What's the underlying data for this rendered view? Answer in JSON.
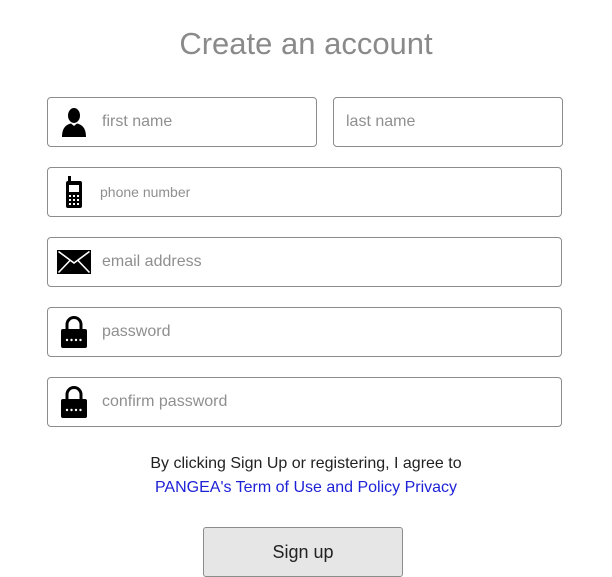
{
  "page": {
    "title": "Create an account"
  },
  "form": {
    "first_name": {
      "placeholder": "first name",
      "value": ""
    },
    "last_name": {
      "placeholder": "last name",
      "value": ""
    },
    "phone": {
      "placeholder": "phone number",
      "value": ""
    },
    "email": {
      "placeholder": "email address",
      "value": ""
    },
    "password": {
      "placeholder": "password",
      "value": ""
    },
    "confirm_password": {
      "placeholder": "confirm password",
      "value": ""
    }
  },
  "icons": {
    "first_name": "person-icon",
    "phone": "mobile-phone-icon",
    "email": "envelope-icon",
    "password": "lock-icon",
    "confirm_password": "lock-icon"
  },
  "terms": {
    "line1": "By clicking Sign Up or registering, I agree to",
    "link_text": "PANGEA's Term of Use and Policy Privacy"
  },
  "buttons": {
    "signup_label": "Sign up"
  },
  "colors": {
    "title": "#8a8a8a",
    "link": "#1e22d6",
    "button_bg": "#e6e6e6",
    "border": "#8c8c8c"
  }
}
